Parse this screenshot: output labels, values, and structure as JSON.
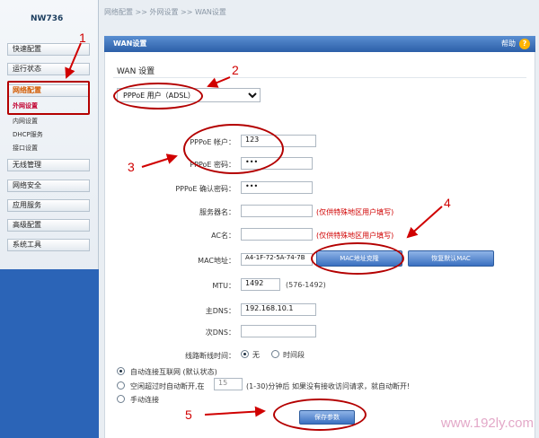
{
  "brand": "NW736",
  "breadcrumb": "网络配置 >> 外网设置 >> WAN设置",
  "sidebar": {
    "items": [
      {
        "label": "快速配置"
      },
      {
        "label": "运行状态"
      },
      {
        "label": "网络配置"
      },
      {
        "label": "无线管理"
      },
      {
        "label": "网络安全"
      },
      {
        "label": "应用服务"
      },
      {
        "label": "高级配置"
      },
      {
        "label": "系统工具"
      }
    ],
    "subitems": [
      {
        "label": "外网设置"
      },
      {
        "label": "内网设置"
      },
      {
        "label": "DHCP服务"
      },
      {
        "label": "接口设置"
      }
    ]
  },
  "header": {
    "tab": "WAN设置",
    "help": "帮助"
  },
  "section_title": "WAN 设置",
  "wan_mode": {
    "selected": "PPPoE 用户（ADSL）"
  },
  "form": {
    "pppoe_user": {
      "label": "PPPoE 帐户：",
      "value": "123"
    },
    "pppoe_pass": {
      "label": "PPPoE 密码：",
      "value": "•••"
    },
    "pppoe_confirm": {
      "label": "PPPoE 确认密码：",
      "value": "•••"
    },
    "service": {
      "label": "服务器名：",
      "value": "",
      "note": "(仅供特殊地区用户填写)"
    },
    "ac": {
      "label": "AC名：",
      "value": "",
      "note": "(仅供特殊地区用户填写)"
    },
    "mac": {
      "label": "MAC地址：",
      "value": "A4-1F-72-5A-74-7B",
      "btn_clone": "MAC地址克隆",
      "btn_restore": "恢复默认MAC"
    },
    "mtu": {
      "label": "MTU：",
      "value": "1492",
      "hint": "(576-1492)"
    },
    "dns1": {
      "label": "主DNS：",
      "value": "192.168.10.1"
    },
    "dns2": {
      "label": "次DNS：",
      "value": ""
    },
    "schedule": {
      "label": "线路断线时间：",
      "opt_none": "无",
      "opt_period": "时间段"
    }
  },
  "connect": {
    "opt_auto": "自动连接互联网 (默认状态)",
    "opt_idle_pre": "空闲超过时自动断开,在",
    "idle_value": "15",
    "opt_idle_post": "(1-30)分钟后 如果没有接收访问请求，就自动断开!",
    "opt_manual": "手动连接"
  },
  "save_button": "保存参数",
  "annotations": [
    "1",
    "2",
    "3",
    "4",
    "5"
  ],
  "watermark": "www.192ly.com",
  "colors": {
    "accent": "#2c5fa8",
    "annotation": "#d00000"
  }
}
